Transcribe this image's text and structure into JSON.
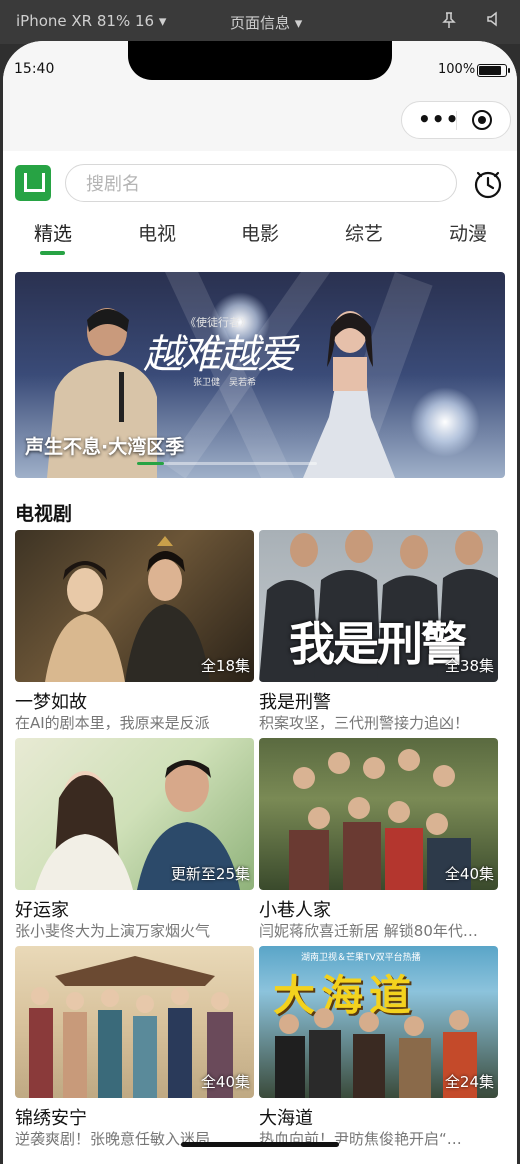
{
  "devtools": {
    "device": "iPhone XR 81% 16 ▾",
    "page_info": "页面信息 ▾"
  },
  "status": {
    "time": "15:40",
    "battery": "100%"
  },
  "search": {
    "placeholder": "搜剧名"
  },
  "tabs": [
    {
      "label": "精选",
      "active": true
    },
    {
      "label": "电视"
    },
    {
      "label": "电影"
    },
    {
      "label": "综艺"
    },
    {
      "label": "动漫"
    }
  ],
  "banner": {
    "title": "声生不息·大湾区季",
    "art_text": "越难越爱",
    "art_sub": "《使徒行者》",
    "art_credits": "张卫健　吴若希",
    "progress": 0.15
  },
  "section": {
    "title": "电视剧"
  },
  "shows": [
    {
      "name": "一梦如故",
      "desc": "在AI的剧本里，我原来是反派",
      "badge": "全18集"
    },
    {
      "name": "我是刑警",
      "desc": "积案攻坚，三代刑警接力追凶！",
      "badge": "全38集",
      "art": "我是刑警"
    },
    {
      "name": "好运家",
      "desc": "张小斐佟大为上演万家烟火气",
      "badge": "更新至25集"
    },
    {
      "name": "小巷人家",
      "desc": "闫妮蒋欣喜迁新居 解锁80年代…",
      "badge": "全40集"
    },
    {
      "name": "锦绣安宁",
      "desc": "逆袭爽剧！张晚意任敏入迷局…",
      "badge": "全40集"
    },
    {
      "name": "大海道",
      "desc": "热血向前！尹昉焦俊艳开启“…",
      "badge": "全24集",
      "art": "大海道",
      "art_top": "湖南卫视＆芒果TV双平台热播"
    }
  ]
}
